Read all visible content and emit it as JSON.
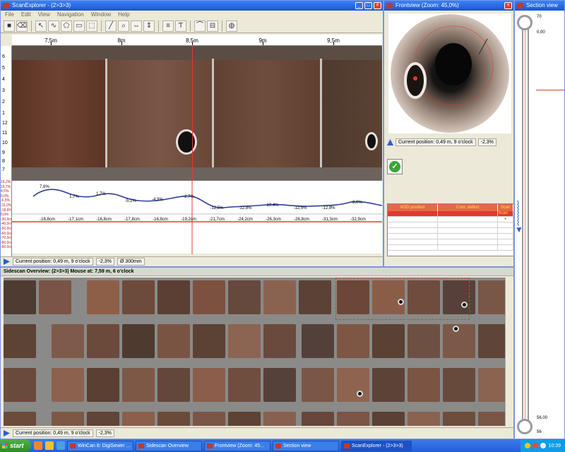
{
  "scan_window": {
    "title": "ScanExplorer - (2>3>3)",
    "menu": [
      "File",
      "Edit",
      "View",
      "Navigation",
      "Window",
      "Help"
    ],
    "ruler_top": [
      "7,5m",
      "8m",
      "8,5m",
      "9m",
      "9,5m"
    ],
    "ruler_left": [
      "6",
      "5",
      "4",
      "3",
      "2",
      "1",
      "12",
      "11",
      "10",
      "9",
      "8",
      "7"
    ],
    "graph_upper_labels": [
      "7,6%",
      "1,7%",
      "1,7%",
      "-5,1%",
      "-4,9%",
      "-2,7%",
      "-12,5%",
      "-12,8%",
      "-10,4%",
      "-12,5%",
      "-12,8%",
      "-8,0%"
    ],
    "graph_lower_labels": [
      "-16,8cm",
      "-17,1cm",
      "-16,8cm",
      "-17,8cm",
      "-16,8cm",
      "-19,2cm",
      "-21,7cm",
      "-24,2cm",
      "-26,3cm",
      "-26,8cm",
      "-31,3cm",
      "-32,9cm"
    ],
    "graph_axis_left": [
      "16,2%",
      "15,7%",
      "4,5%",
      "0,0%",
      "-6,5%",
      "-11,0%",
      "-18,6%",
      "0,0m",
      "-30,0cm",
      "-40,0cm",
      "-50,0cm",
      "-60,0cm",
      "-70,0cm",
      "-80,0cm",
      "-90,0cm"
    ],
    "status": {
      "position": "Current position: 0,49 m, 9 o'clock",
      "percent": "-2,3%",
      "diameter": "Ø 300mm"
    }
  },
  "front_window": {
    "title": "Frontview (Zoom: 45,0%)",
    "position": "Current position: 0,49 m, 9 o'clock",
    "percent": "-2,3%",
    "table_headers": [
      "VOD position",
      "Cont. defect",
      "Scan"
    ],
    "table_cell_top": "Scan"
  },
  "section_window": {
    "title": "Section view",
    "top_value": "0,00",
    "top_index": "70",
    "bottom_value": "56,00",
    "bottom_index": "56"
  },
  "sidescan_window": {
    "title": "Sidescan Overview: (2>3>3) Mouse at: 7,59 m, 6 o'clock",
    "position": "Current position: 0,49 m, 9 o'clock",
    "percent": "-2,3%"
  },
  "taskbar": {
    "start": "start",
    "items": [
      "WinCan 8: DigiSewer ...",
      "Sidescan Overview",
      "Frontview (Zoom: 45...",
      "Section view",
      "ScanExplorer - (2>3>3)"
    ],
    "clock": "10:39"
  },
  "colors": {
    "cursor": "#e53b2a",
    "graph_line": "#2d3e9a",
    "accent": "#2a5fd0"
  }
}
